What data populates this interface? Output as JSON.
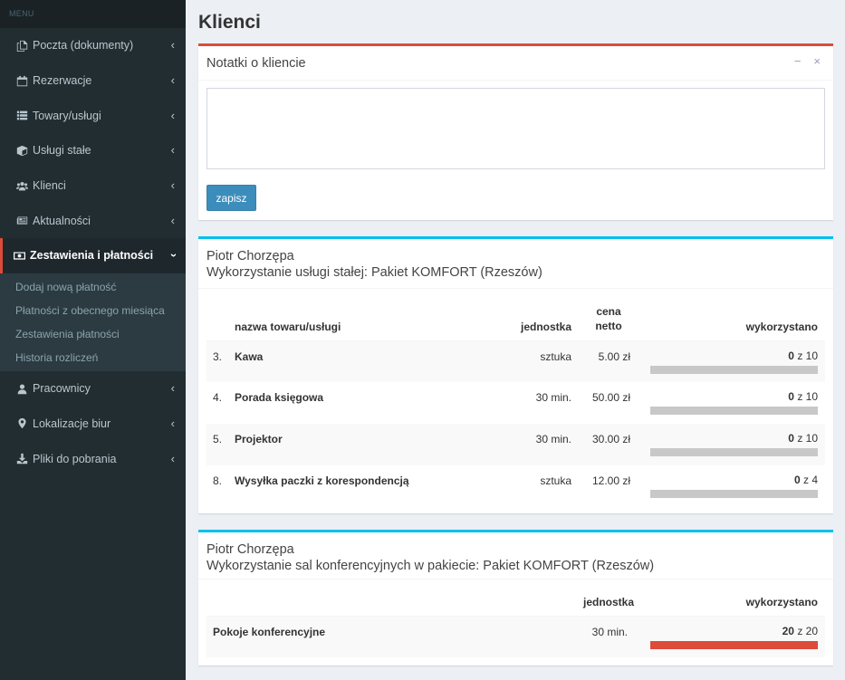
{
  "sidebar": {
    "header": "MENU",
    "items": [
      {
        "label": "Poczta (dokumenty)",
        "icon": "copy-icon"
      },
      {
        "label": "Rezerwacje",
        "icon": "calendar-icon"
      },
      {
        "label": "Towary/usługi",
        "icon": "list-icon"
      },
      {
        "label": "Usługi stałe",
        "icon": "cube-icon"
      },
      {
        "label": "Klienci",
        "icon": "users-icon"
      },
      {
        "label": "Aktualności",
        "icon": "newspaper-icon"
      },
      {
        "label": "Zestawienia i płatności",
        "icon": "money-icon",
        "active": true
      },
      {
        "label": "Pracownicy",
        "icon": "user-icon"
      },
      {
        "label": "Lokalizacje biur",
        "icon": "map-marker-icon"
      },
      {
        "label": "Pliki do pobrania",
        "icon": "download-icon"
      }
    ],
    "submenu": [
      {
        "label": "Dodaj nową płatność"
      },
      {
        "label": "Płatności z obecnego miesiąca"
      },
      {
        "label": "Zestawienia płatności"
      },
      {
        "label": "Historia rozliczeń"
      }
    ]
  },
  "page": {
    "title": "Klienci"
  },
  "notes": {
    "title": "Notatki o kliencie",
    "minimize": "−",
    "close": "×",
    "textarea_value": "",
    "save_label": "zapisz"
  },
  "services": {
    "client": "Piotr Chorzępa",
    "subtitle": "Wykorzystanie usługi stałej: Pakiet KOMFORT (Rzeszów)",
    "columns": {
      "name": "nazwa towaru/usługi",
      "unit": "jednostka",
      "price_top": "cena",
      "price_bottom": "netto",
      "used": "wykorzystano"
    },
    "rows": [
      {
        "no": "3.",
        "name": "Kawa",
        "unit": "sztuka",
        "price": "5.00 zł",
        "used": "0",
        "of": "z 10",
        "progress": 0
      },
      {
        "no": "4.",
        "name": "Porada księgowa",
        "unit": "30 min.",
        "price": "50.00 zł",
        "used": "0",
        "of": "z 10",
        "progress": 0
      },
      {
        "no": "5.",
        "name": "Projektor",
        "unit": "30 min.",
        "price": "30.00 zł",
        "used": "0",
        "of": "z 10",
        "progress": 0
      },
      {
        "no": "8.",
        "name": "Wysyłka paczki z korespondencją",
        "unit": "sztuka",
        "price": "12.00 zł",
        "used": "0",
        "of": "z 4",
        "progress": 0
      }
    ]
  },
  "rooms": {
    "client": "Piotr Chorzępa",
    "subtitle": "Wykorzystanie sal konferencyjnych w pakiecie: Pakiet KOMFORT (Rzeszów)",
    "columns": {
      "unit": "jednostka",
      "used": "wykorzystano"
    },
    "rows": [
      {
        "name": "Pokoje konferencyjne",
        "unit": "30 min.",
        "used": "20",
        "of": "z 20",
        "progress": 1
      }
    ]
  },
  "colors": {
    "accent_red": "#dd4b39",
    "accent_blue": "#00c0ef",
    "sidebar_bg": "#222d32",
    "button": "#3c8dbc"
  }
}
